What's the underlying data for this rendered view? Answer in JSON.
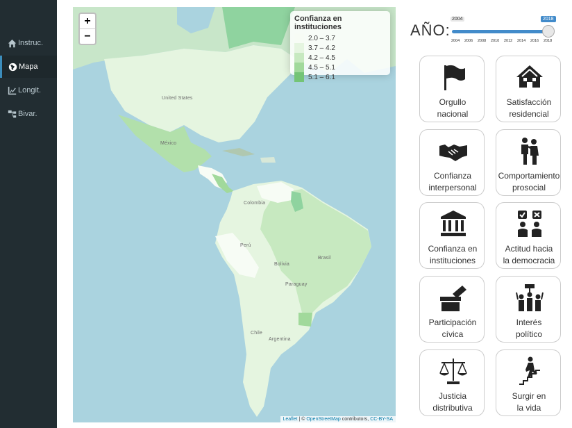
{
  "sidebar": {
    "items": [
      {
        "label": "Instruc.",
        "icon": "home-icon"
      },
      {
        "label": "Mapa",
        "icon": "globe-icon"
      },
      {
        "label": "Longit.",
        "icon": "line-chart-icon"
      },
      {
        "label": "Bivar.",
        "icon": "sitemap-icon"
      }
    ],
    "active": "Mapa"
  },
  "map": {
    "zoom_in": "+",
    "zoom_out": "−",
    "legend": {
      "title": "Confianza en instituciones",
      "classes": [
        {
          "label": "2.0 – 3.7",
          "color": "#f7fcf5"
        },
        {
          "label": "3.7 – 4.2",
          "color": "#e5f5e0"
        },
        {
          "label": "4.2 – 4.5",
          "color": "#c7e9c0"
        },
        {
          "label": "4.5 – 5.1",
          "color": "#a1d99b"
        },
        {
          "label": "5.1 – 6.1",
          "color": "#74c476"
        }
      ]
    },
    "country_labels": [
      "United States",
      "México",
      "Colombia",
      "Perú",
      "Bolivia",
      "Brasil",
      "Paraguay",
      "Chile",
      "Argentina"
    ],
    "attribution": {
      "leaflet": "Leaflet",
      "sep": " | © ",
      "osm": "OpenStreetMap",
      "contrib": " contributors, ",
      "license": "CC-BY-SA"
    }
  },
  "year": {
    "label": "AÑO:",
    "min": "2004",
    "max": "2018",
    "value": "2018",
    "ticks": [
      "2004",
      "2006",
      "2008",
      "2010",
      "2012",
      "2014",
      "2016",
      "2018"
    ]
  },
  "themes": [
    {
      "label": "Orgullo\nnacional",
      "icon": "flag-icon"
    },
    {
      "label": "Satisfacción\nresidencial",
      "icon": "houses-icon"
    },
    {
      "label": "Confianza\ninterpersonal",
      "icon": "handshake-icon"
    },
    {
      "label": "Comportamiento\nprosocial",
      "icon": "people-helping-icon"
    },
    {
      "label": "Confianza en\ninstituciones",
      "icon": "institution-icon"
    },
    {
      "label": "Actitud hacia\nla democracia",
      "icon": "vote-people-icon"
    },
    {
      "label": "Participación\ncívica",
      "icon": "ballot-box-icon"
    },
    {
      "label": "Interés\npolítico",
      "icon": "protest-icon"
    },
    {
      "label": "Justicia\ndistributiva",
      "icon": "scales-icon"
    },
    {
      "label": "Surgir en\nla vida",
      "icon": "stairs-climb-icon"
    }
  ]
}
